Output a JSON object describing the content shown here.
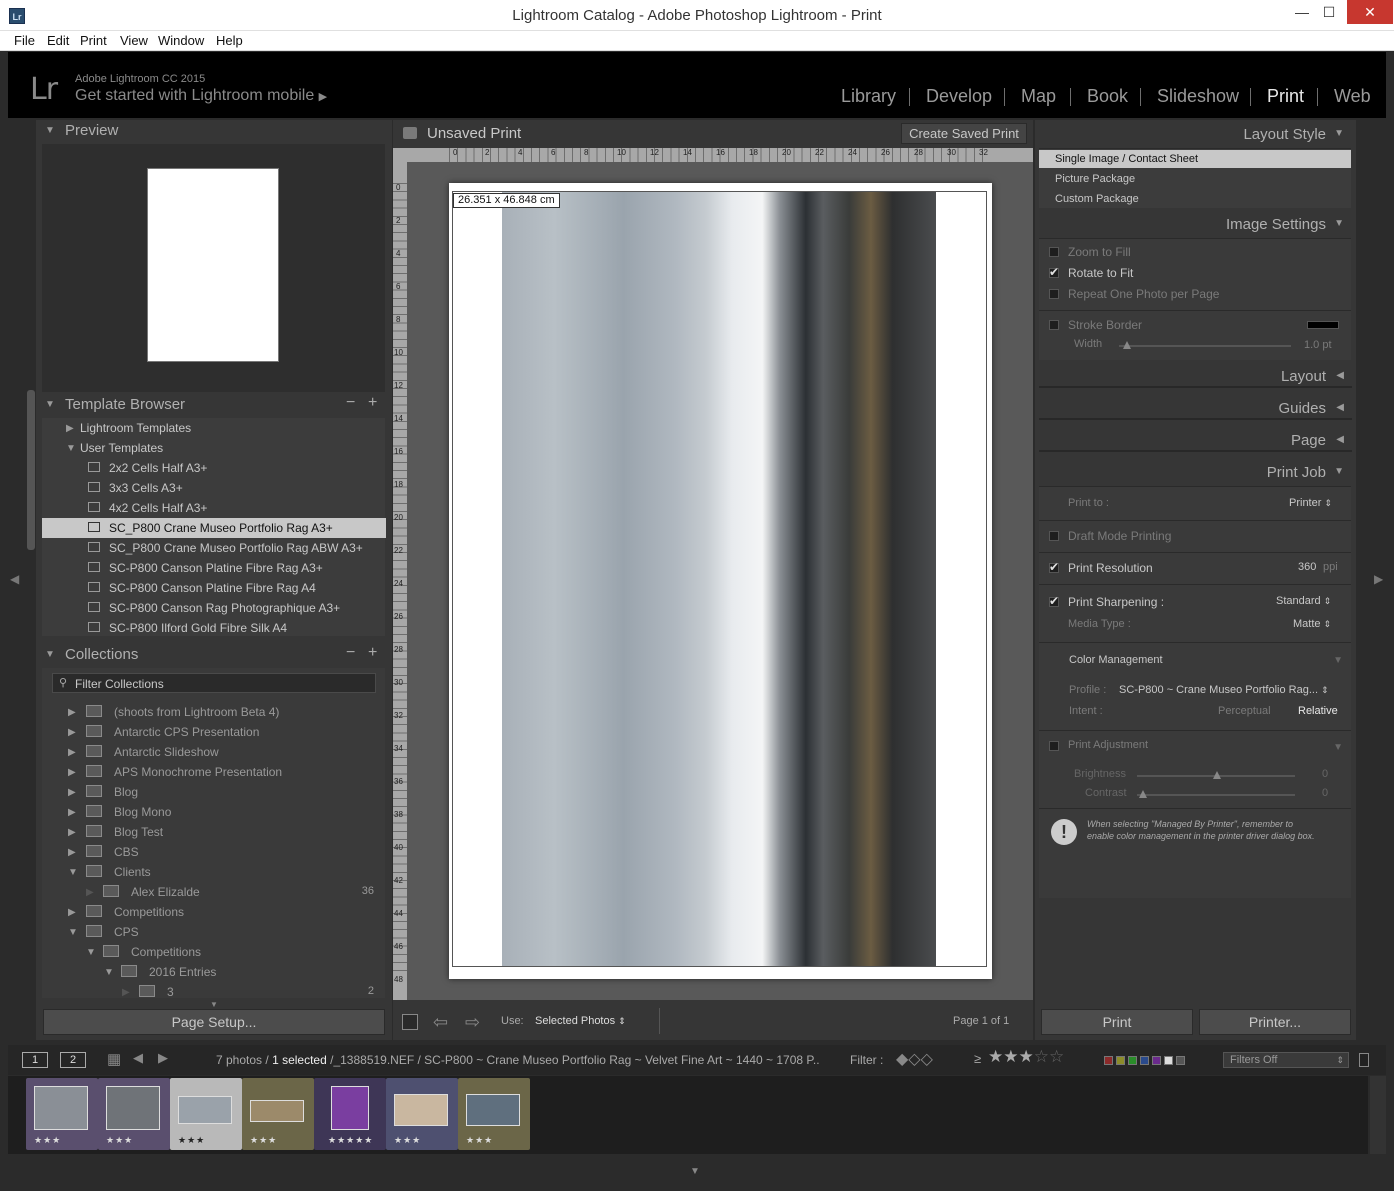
{
  "window": {
    "title": "Lightroom Catalog - Adobe Photoshop Lightroom - Print",
    "app_icon": "Lr",
    "minimize": "—",
    "maximize": "☐",
    "close": "✕"
  },
  "menu": [
    "File",
    "Edit",
    "Print",
    "View",
    "Window",
    "Help"
  ],
  "identity": {
    "logo": "Lr",
    "version": "Adobe Lightroom CC 2015",
    "mobile_prompt": "Get started with Lightroom mobile"
  },
  "modules": [
    "Library",
    "Develop",
    "Map",
    "Book",
    "Slideshow",
    "Print",
    "Web"
  ],
  "active_module": "Print",
  "left": {
    "preview_title": "Preview",
    "template_browser_title": "Template Browser",
    "template_folders": [
      {
        "label": "Lightroom Templates",
        "expanded": false
      },
      {
        "label": "User Templates",
        "expanded": true
      }
    ],
    "templates": [
      "2x2 Cells Half A3+",
      "3x3 Cells A3+",
      "4x2 Cells Half A3+",
      "SC_P800 Crane Museo Portfolio Rag A3+",
      "SC_P800 Crane Museo Portfolio Rag ABW A3+",
      "SC-P800 Canson Platine Fibre Rag A3+",
      "SC-P800 Canson Platine Fibre Rag A4",
      "SC-P800 Canson Rag Photographique A3+",
      "SC-P800 Ilford Gold Fibre Silk A4"
    ],
    "selected_template": "SC_P800 Crane Museo Portfolio Rag A3+",
    "collections_title": "Collections",
    "filter_placeholder": "Filter Collections",
    "collections": [
      {
        "label": "(shoots from Lightroom Beta 4)",
        "level": 0,
        "expanded": false,
        "count": ""
      },
      {
        "label": "Antarctic CPS Presentation",
        "level": 0,
        "expanded": false,
        "count": ""
      },
      {
        "label": "Antarctic Slideshow",
        "level": 0,
        "expanded": false,
        "count": ""
      },
      {
        "label": "APS Monochrome Presentation",
        "level": 0,
        "expanded": false,
        "count": ""
      },
      {
        "label": "Blog",
        "level": 0,
        "expanded": false,
        "count": ""
      },
      {
        "label": "Blog Mono",
        "level": 0,
        "expanded": false,
        "count": ""
      },
      {
        "label": "Blog Test",
        "level": 0,
        "expanded": false,
        "count": ""
      },
      {
        "label": "CBS",
        "level": 0,
        "expanded": false,
        "count": ""
      },
      {
        "label": "Clients",
        "level": 0,
        "expanded": true,
        "count": ""
      },
      {
        "label": "Alex Elizalde",
        "level": 1,
        "expanded": false,
        "count": "36"
      },
      {
        "label": "Competitions",
        "level": 0,
        "expanded": false,
        "count": ""
      },
      {
        "label": "CPS",
        "level": 0,
        "expanded": true,
        "count": ""
      },
      {
        "label": "Competitions",
        "level": 1,
        "expanded": true,
        "count": ""
      },
      {
        "label": "2016 Entries",
        "level": 2,
        "expanded": true,
        "count": ""
      },
      {
        "label": "3",
        "level": 3,
        "expanded": false,
        "count": "2"
      }
    ],
    "page_setup_label": "Page Setup..."
  },
  "center": {
    "title": "Unsaved Print",
    "create_saved": "Create Saved Print",
    "dimensions": "26.351 x 46.848 cm",
    "ruler_h": [
      "0",
      "2",
      "4",
      "6",
      "8",
      "10",
      "12",
      "14",
      "16",
      "18",
      "20",
      "22",
      "24",
      "26",
      "28",
      "30",
      "32"
    ],
    "ruler_v": [
      "0",
      "2",
      "4",
      "6",
      "8",
      "10",
      "12",
      "14",
      "16",
      "18",
      "20",
      "22",
      "24",
      "26",
      "28",
      "30",
      "32",
      "34",
      "36",
      "38",
      "40",
      "42",
      "44",
      "46",
      "48"
    ],
    "use_label": "Use:",
    "use_value": "Selected Photos",
    "page_info": "Page 1 of 1"
  },
  "right": {
    "layout_style_title": "Layout Style",
    "layout_styles": [
      "Single Image / Contact Sheet",
      "Picture Package",
      "Custom Package"
    ],
    "selected_layout_style": "Single Image / Contact Sheet",
    "image_settings_title": "Image Settings",
    "zoom_to_fill": {
      "label": "Zoom to Fill",
      "checked": false
    },
    "rotate_to_fit": {
      "label": "Rotate to Fit",
      "checked": true
    },
    "repeat_one": {
      "label": "Repeat One Photo per Page",
      "checked": false
    },
    "stroke_border": {
      "label": "Stroke Border",
      "checked": false
    },
    "width_label": "Width",
    "width_value": "1.0 pt",
    "collapsed_panels": [
      "Layout",
      "Guides",
      "Page"
    ],
    "print_job_title": "Print Job",
    "print_to_label": "Print to :",
    "print_to_value": "Printer",
    "draft_mode": {
      "label": "Draft Mode Printing",
      "checked": false
    },
    "print_resolution": {
      "label": "Print Resolution",
      "checked": true,
      "value": "360",
      "unit": "ppi"
    },
    "print_sharpening": {
      "label": "Print Sharpening :",
      "checked": true,
      "value": "Standard"
    },
    "media_type_label": "Media Type :",
    "media_type_value": "Matte",
    "color_mgmt_title": "Color Management",
    "profile_label": "Profile :",
    "profile_value": "SC-P800 ~ Crane Museo Portfolio Rag...",
    "intent_label": "Intent :",
    "intent_perceptual": "Perceptual",
    "intent_relative": "Relative",
    "print_adjustment": {
      "label": "Print Adjustment",
      "checked": false
    },
    "brightness_label": "Brightness",
    "brightness_value": "0",
    "contrast_label": "Contrast",
    "contrast_value": "0",
    "warning_line1": "When selecting \"Managed By Printer\", remember to",
    "warning_line2": "enable color management in the printer driver dialog box.",
    "print_btn": "Print",
    "printer_btn": "Printer..."
  },
  "filmbar": {
    "page1": "1",
    "page2": "2",
    "count_prefix": "7 photos /",
    "selected": "1 selected",
    "path": "/_1388519.NEF / SC-P800 ~ Crane Museo Portfolio Rag ~ Velvet Fine Art ~ 1440 ~ 1708 P..",
    "filter_label": "Filter :",
    "gte": "≥",
    "filters_off": "Filters Off"
  },
  "thumbnails": [
    {
      "stars": "★★★",
      "bg": "#5a4f6e",
      "img": "#8a8f96"
    },
    {
      "stars": "★★★",
      "bg": "#5a4f6e",
      "img": "#6f7378"
    },
    {
      "stars": "★★★",
      "bg": "#b9b9b9",
      "img": "#9aa2aa"
    },
    {
      "stars": "★★★",
      "bg": "#6b6648",
      "img": "#9c8a6a"
    },
    {
      "stars": "★★★★★",
      "bg": "#3e3656",
      "img": "#7a3ea0"
    },
    {
      "stars": "★★★",
      "bg": "#4e5070",
      "img": "#c9b7a0"
    },
    {
      "stars": "★★★",
      "bg": "#6b6648",
      "img": "#5f6f7e"
    }
  ]
}
